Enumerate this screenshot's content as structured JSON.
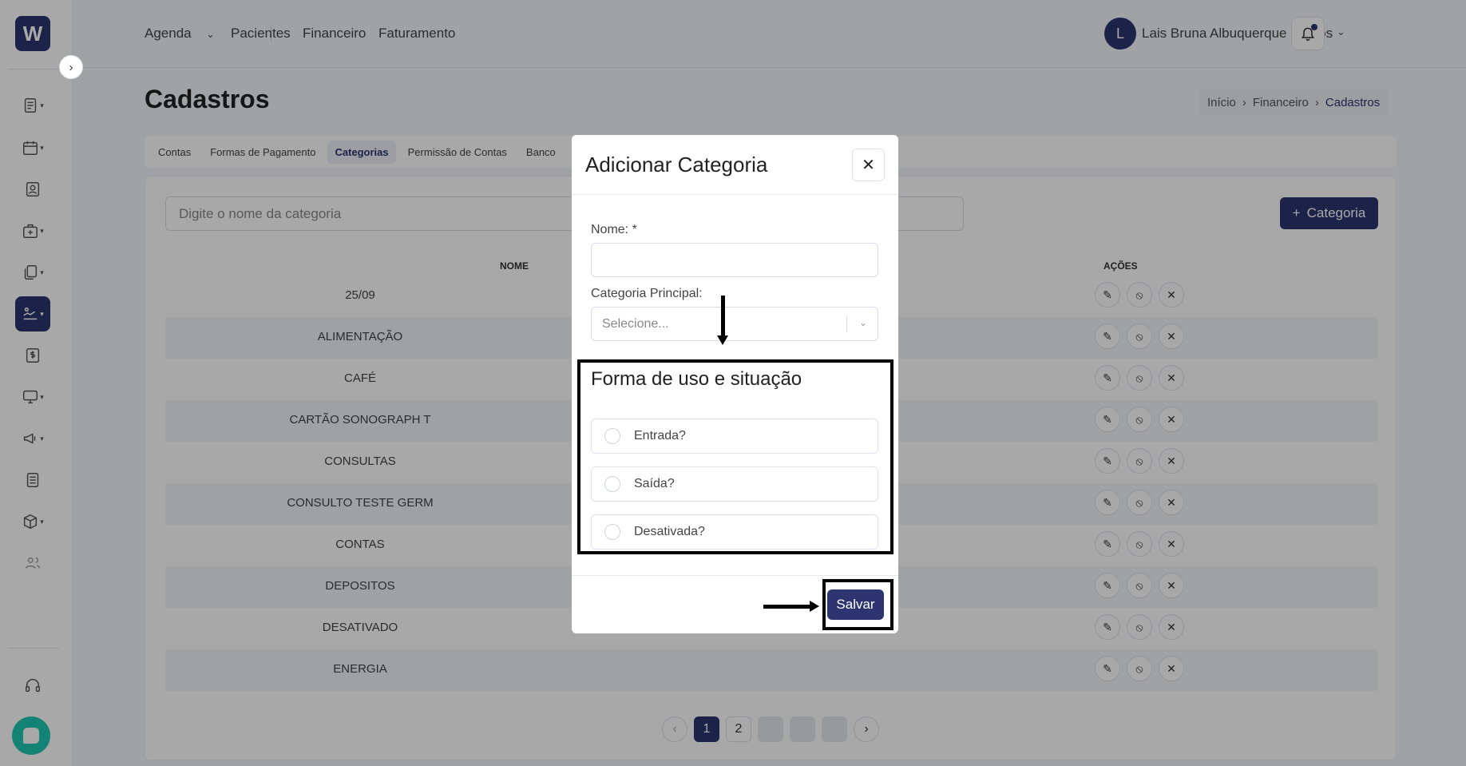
{
  "app": {
    "logo": "W"
  },
  "topnav": {
    "agenda": "Agenda",
    "pacientes": "Pacientes",
    "financeiro": "Financeiro",
    "faturamento": "Faturamento",
    "user_initial": "L",
    "user_name": "Lais Bruna Albuquerque Santos"
  },
  "page": {
    "title": "Cadastros"
  },
  "breadcrumb": {
    "home": "Início",
    "parent": "Financeiro",
    "current": "Cadastros"
  },
  "tabs": [
    "Contas",
    "Formas de Pagamento",
    "Categorias",
    "Permissão de Contas",
    "Banco"
  ],
  "search": {
    "placeholder": "Digite o nome da categoria"
  },
  "add_button": {
    "label": "Categoria"
  },
  "table": {
    "headers": {
      "name": "NOME",
      "actions": "AÇÕES"
    },
    "rows": [
      "25/09",
      "ALIMENTAÇÃO",
      "CAFÉ",
      "CARTÃO SONOGRAPH T",
      "CONSULTAS",
      "CONSULTO TESTE GERM",
      "CONTAS",
      "DEPOSITOS",
      "DESATIVADO",
      "ENERGIA"
    ]
  },
  "pagination": {
    "page1": "1",
    "page2": "2"
  },
  "modal": {
    "title": "Adicionar Categoria",
    "name_label": "Nome: *",
    "parent_label": "Categoria Principal:",
    "parent_placeholder": "Selecione...",
    "section_title": "Forma de uso e situação",
    "options": [
      "Entrada?",
      "Saída?",
      "Desativada?"
    ],
    "save_label": "Salvar"
  }
}
